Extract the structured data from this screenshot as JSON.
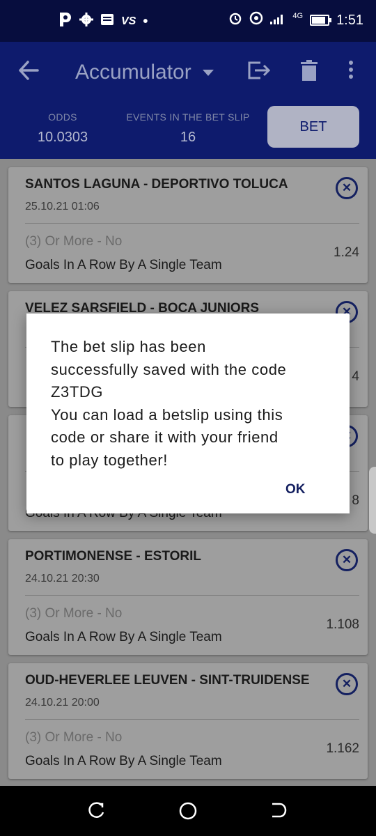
{
  "status_bar": {
    "left_icons": [
      "p-app-icon",
      "gear-icon",
      "message-icon",
      "vs-icon",
      "dot-icon"
    ],
    "right_icons": [
      "alarm-icon",
      "hotspot-icon",
      "signal-icon",
      "4g-signal-icon",
      "battery-icon"
    ],
    "time": "1:51",
    "network_label": "4G",
    "battery_level": 0.85
  },
  "app_bar": {
    "title": "Accumulator",
    "odds_label": "ODDS",
    "odds_value": "10.0303",
    "events_label": "EVENTS IN THE BET SLIP",
    "events_value": "16",
    "bet_button": "BET"
  },
  "bets": [
    {
      "match": "SANTOS LAGUNA - DEPORTIVO TOLUCA",
      "date": "25.10.21 01:06",
      "pick": "(3) Or More - No",
      "market": "Goals In A Row By A Single Team",
      "odd": "1.24"
    },
    {
      "match": "VELEZ SARSFIELD - BOCA JUNIORS",
      "date": "",
      "pick": "",
      "market": "",
      "odd": "4"
    },
    {
      "match": "",
      "date": "",
      "pick": "",
      "market": "Goals In A Row By A Single Team",
      "odd": "8"
    },
    {
      "match": "PORTIMONENSE - ESTORIL",
      "date": "24.10.21 20:30",
      "pick": "(3) Or More - No",
      "market": "Goals In A Row By A Single Team",
      "odd": "1.108"
    },
    {
      "match": "OUD-HEVERLEE LEUVEN - SINT-TRUIDENSE",
      "date": "24.10.21 20:00",
      "pick": "(3) Or More - No",
      "market": "Goals In A Row By A Single Team",
      "odd": "1.162"
    }
  ],
  "dialog": {
    "message_lines": [
      "The bet slip has been",
      "successfully saved with the code",
      "Z3TDG",
      "You can load a betslip using this",
      "code or share it with your friend",
      "to play together!"
    ],
    "ok_label": "OK"
  },
  "colors": {
    "status_bar": "#070d3e",
    "app_bar": "#0e1b6d",
    "accent": "#142060",
    "scrim": "#8a8a8a"
  }
}
